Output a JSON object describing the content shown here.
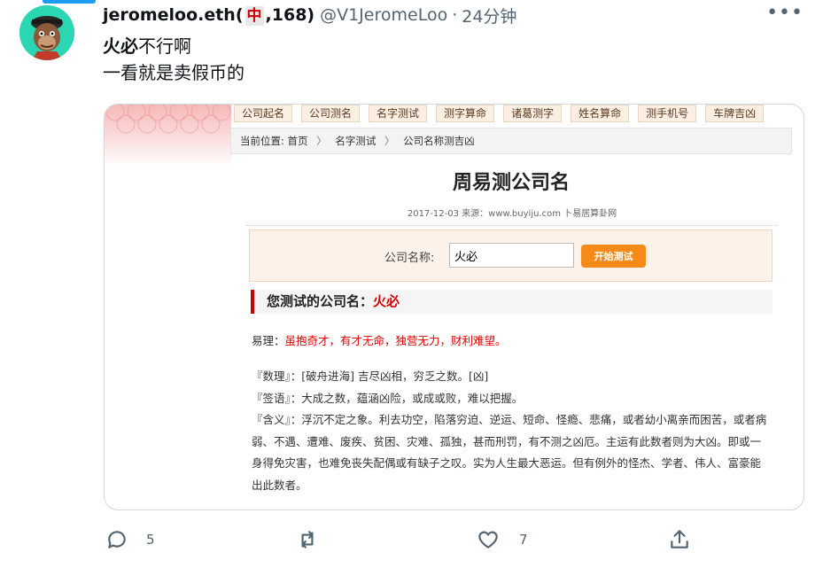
{
  "tweet": {
    "display_name_pre": "jeromeloo.eth(",
    "flag_glyph": "中",
    "display_name_post": ",168)",
    "handle": "@V1JeromeLoo",
    "separator": "·",
    "time": "24分钟",
    "more": "•••",
    "text_bold": "火必",
    "text_line1_rest": "不行啊",
    "text_line2": "一看就是卖假币的"
  },
  "embedded": {
    "nav": [
      "公司起名",
      "公司测名",
      "名字测试",
      "测字算命",
      "诸葛测字",
      "姓名算命",
      "测手机号",
      "车牌吉凶"
    ],
    "breadcrumb": {
      "label": "当前位置:",
      "items": [
        "首页",
        "名字测试",
        "公司名称测吉凶"
      ],
      "sep": "〉"
    },
    "title": "周易测公司名",
    "meta": "2017-12-03 来源：www.buyiju.com 卜易居算卦网",
    "form": {
      "label": "公司名称:",
      "value": "火必",
      "button": "开始测试"
    },
    "result_label": "您测试的公司名：",
    "result_name": "火必",
    "yili_label": "易理：",
    "yili_text": "虽抱奇才，有才无命，独营无力，财利难望。",
    "lines": [
      "『数理』：[破舟进海] 吉尽凶相，穷乏之数。[凶]",
      "『签语』：大成之数，蕴涵凶险，或成或败，难以把握。",
      "『含义』：浮沉不定之象。利去功空，陷落穷迫、逆运、短命、怪瘾、悲痛，或者幼小离亲而困苦，或者病弱、不遇、遭难、废疾、贫困、灾难、孤独，甚而刑罚，有不测之凶厄。主运有此数者则为大凶。即或一身得免灾害，也难免丧失配偶或有缺子之叹。实为人生最大恶运。但有例外的怪杰、学者、伟人、富豪能出此数者。"
    ]
  },
  "actions": {
    "reply_count": "5",
    "retweet_count": "",
    "like_count": "7"
  },
  "colors": {
    "accent": "#1d9bf0",
    "secondary_text": "#536471",
    "button_orange": "#f58a19",
    "result_red": "#d40000"
  }
}
